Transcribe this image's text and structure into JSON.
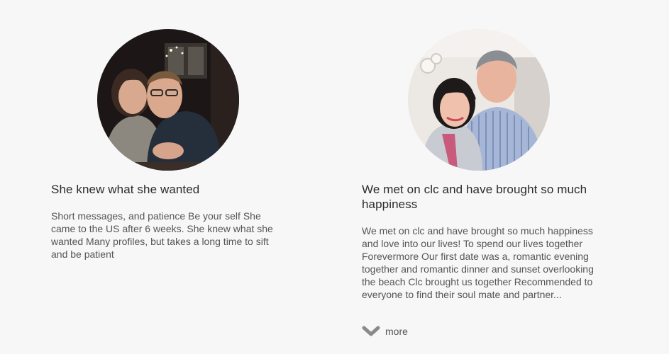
{
  "testimonials": [
    {
      "title": "She knew what she wanted",
      "body": "Short messages, and patience Be your self She came to the US after 6 weeks. She knew what she wanted Many profiles, but takes a long time to sift and be patient"
    },
    {
      "title": "We met on clc and have brought so much happiness",
      "body": "We met on clc and have brought so much happiness and love into our lives! To spend our lives together Forevermore Our first date was a, romantic evening together and romantic dinner and sunset overlooking the beach Clc brought us together Recommended to everyone to find their soul mate and partner...",
      "more_label": "more",
      "more_icon": "chevron-down-icon"
    }
  ],
  "colors": {
    "background": "#f7f7f8",
    "title_text": "#2b2b2b",
    "body_text": "#555555",
    "chevron": "#8a8a8a"
  }
}
